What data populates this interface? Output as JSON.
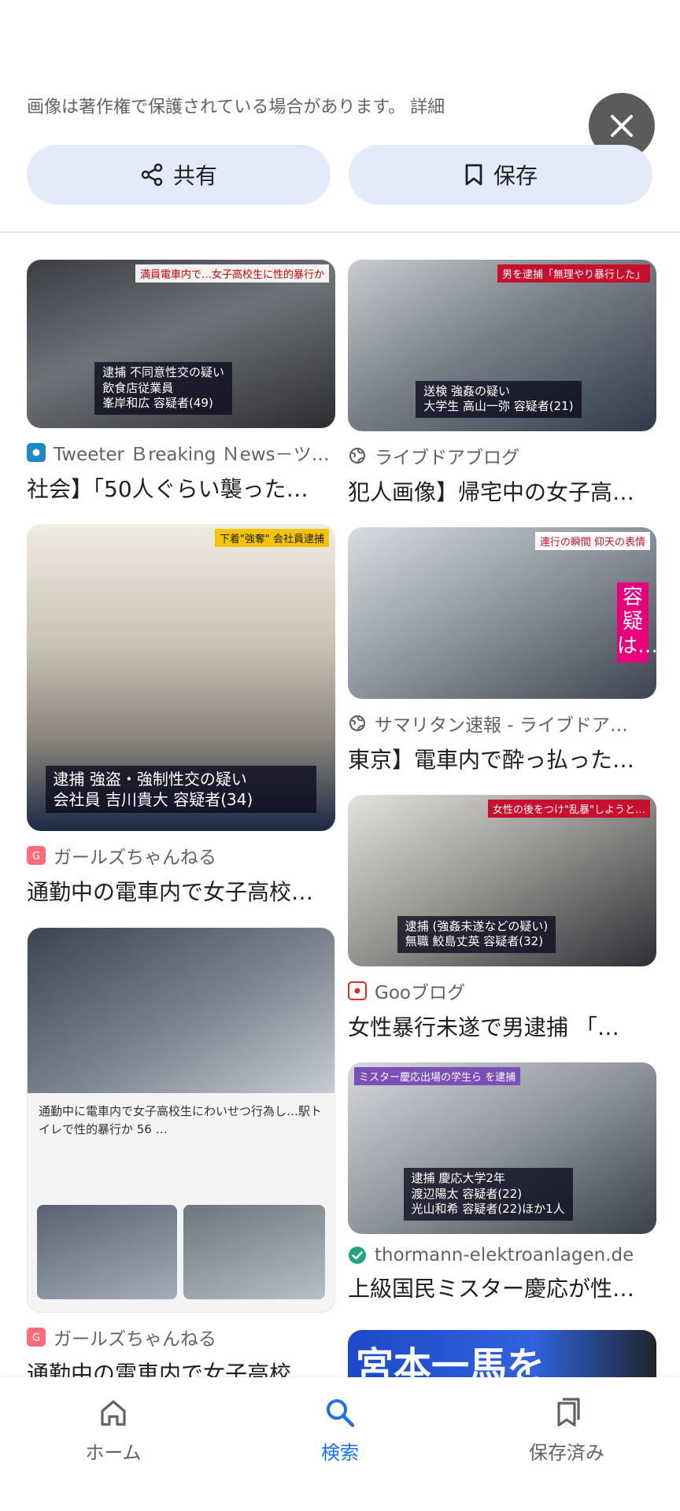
{
  "header": {
    "notice": "画像は著作権で保護されている場合があります。",
    "detail_link": "詳細",
    "share_label": "共有",
    "save_label": "保存"
  },
  "results": [
    {
      "source": "Tweeter Ｂreaking Ｎews－ツ…",
      "title": "社会】「50人ぐらい襲った…",
      "caption_lines": [
        "逮捕 不同意性交の疑い",
        "飲食店従業員",
        "峯岸和広 容疑者(49)"
      ],
      "tag": "満員電車内で…女子高校生に性的暴行か",
      "source_icon": "tweeter-icon"
    },
    {
      "source": "ライブドアブログ",
      "title": "犯人画像】帰宅中の女子高…",
      "caption_lines": [
        "送検 強姦の疑い",
        "大学生 高山一弥 容疑者(21)"
      ],
      "tag": "男を逮捕「無理やり暴行した」",
      "source_icon": "globe-icon"
    },
    {
      "source": "ガールズちゃんねる",
      "title": "通勤中の電車内で女子高校…",
      "caption_lines": [
        "逮捕 強盗・強制性交の疑い",
        "会社員 吉川貴大 容疑者(34)"
      ],
      "tag": "下着\"強奪\" 会社員逮捕",
      "source_icon": "girls-channel-icon"
    },
    {
      "source": "サマリタン速報 - ライブドア…",
      "title": "東京】電車内で酔っ払った…",
      "caption_lines": [
        "容疑は…"
      ],
      "tag": "連行の瞬間 仰天の表情",
      "source_icon": "globe-icon"
    },
    {
      "source": "Gooブログ",
      "title": "女性暴行未遂で男逮捕 「…",
      "caption_lines": [
        "逮捕 (強姦未遂などの疑い)",
        "無職 鮫島丈英 容疑者(32)"
      ],
      "tag": "女性の後をつけ\"乱暴\"しようと…",
      "source_icon": "goo-icon"
    },
    {
      "source": "ガールズちゃんねる",
      "title": "通勤中の電車内で女子高校…",
      "caption_lines": [
        "通勤中に電車内で女子高校生にわいせつ行為し…駅トイレで性的暴行か 56 …"
      ],
      "tag": "",
      "source_icon": "girls-channel-icon"
    },
    {
      "source": "thormann-elektroanlagen.de",
      "title": "上級国民ミスター慶応が性…",
      "caption_lines": [
        "逮捕 慶応大学2年",
        "渡辺陽太 容疑者(22)",
        "光山和希 容疑者(22)ほか1人"
      ],
      "tag": "ミスター慶応出場の学生ら を逮捕",
      "source_icon": "verified-icon"
    },
    {
      "source": "",
      "title": "",
      "caption_lines": [
        "宮本一馬を"
      ],
      "tag": "",
      "source_icon": ""
    }
  ],
  "nav": {
    "home_label": "ホーム",
    "search_label": "検索",
    "saved_label": "保存済み"
  },
  "colors": {
    "accent": "#1a73e8",
    "button_bg": "#e3ebfa",
    "close_bg": "#5b5b5b"
  }
}
